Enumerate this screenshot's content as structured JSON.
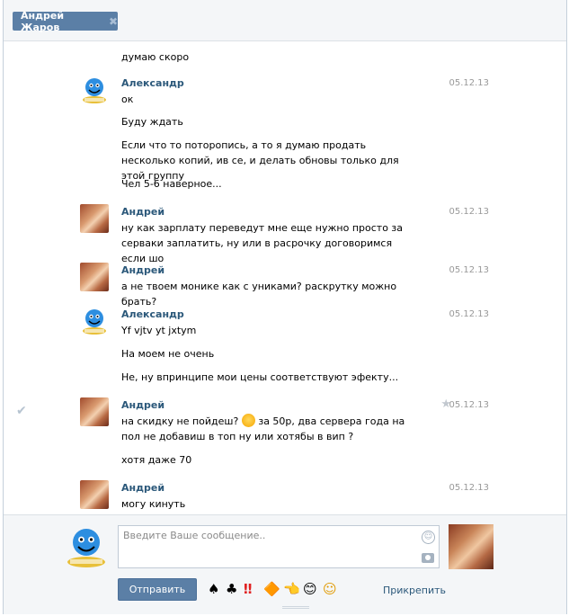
{
  "tab": {
    "title": "Андрей Жаров",
    "close_glyph": "✖"
  },
  "users": {
    "alexander": "Александр",
    "andrey": "Андрей"
  },
  "messages": [
    {
      "text": "думаю скоро"
    },
    {
      "author": "Александр",
      "date": "05.12.13",
      "lines": [
        "ок",
        "Буду ждать",
        "Если что то поторопись, а то я думаю продать несколько копий, ив се, и делать обновы только для этой группу",
        "Чел 5-6 наверное..."
      ]
    },
    {
      "author": "Андрей",
      "date": "05.12.13",
      "lines": [
        "ну как зарплату переведут мне еще нужно просто за серваки заплатить, ну или в расрочку договоримся если шо"
      ]
    },
    {
      "author": "Андрей",
      "date": "05.12.13",
      "lines": [
        "а не твоем монике как с униками? раскрутку можно брать?"
      ]
    },
    {
      "author": "Александр",
      "date": "05.12.13",
      "lines": [
        "Yf vjtv yt jxtym",
        "На моем не очень",
        "Не, ну впринципе мои цены соответствуют эфекту..."
      ]
    },
    {
      "author": "Андрей",
      "date": "05.12.13",
      "lines": [
        "на скидку не пойдеш?",
        "за 50р, два сервера года на пол не добавиш в топ ну или хотябы в вип ?",
        "хотя даже 70"
      ]
    },
    {
      "author": "Андрей",
      "date": "05.12.13",
      "lines": [
        "могу кинуть"
      ]
    }
  ],
  "composer": {
    "placeholder": "Введите Ваше сообщение..",
    "send_label": "Отправить",
    "attach_label": "Прикрепить",
    "quick_emoji": [
      "♠",
      "♣",
      "‼",
      "🔶",
      "👈",
      "😊",
      "☺"
    ]
  },
  "icons": {
    "read_mark": "✔",
    "star": "★",
    "smile": "☺"
  },
  "colors": {
    "accent": "#5b7fa6",
    "author": "#2b587a",
    "date": "#999999"
  }
}
